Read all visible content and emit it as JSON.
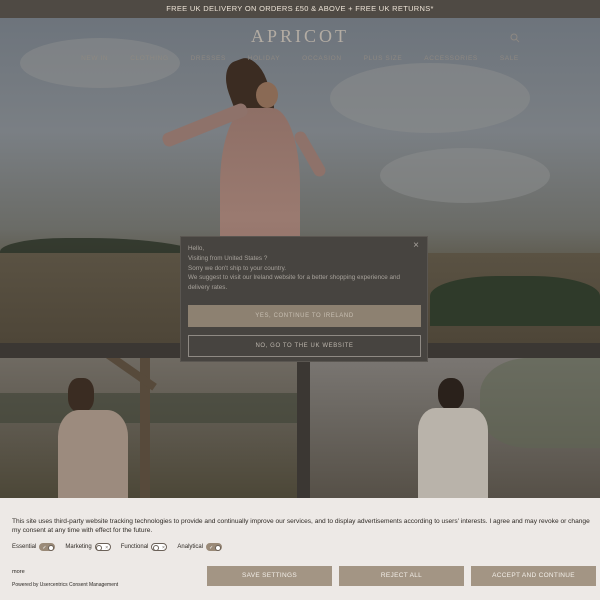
{
  "announcement": "FREE UK DELIVERY ON ORDERS £50 & ABOVE + FREE UK RETURNS*",
  "brand": {
    "logo_text": "APRICOT"
  },
  "header": {
    "icons": [
      "search-icon",
      "account-icon",
      "wishlist-icon",
      "bag-icon"
    ]
  },
  "nav": {
    "items": [
      "NEW IN",
      "CLOTHING",
      "DRESSES",
      "HOLIDAY",
      "OCCASION",
      "PLUS SIZE",
      "ACCESSORIES",
      "SALE"
    ]
  },
  "geo_popup": {
    "close_icon": "close-icon",
    "lines": [
      "Hello,",
      "Visiting from United States ?",
      "Sorry we don't ship to your country.",
      "We suggest to visit our Ireland website for a better shopping experience and delivery rates."
    ],
    "primary_button": "YES, CONTINUE TO IRELAND",
    "secondary_button": "NO, GO TO THE UK WEBSITE"
  },
  "cookie_banner": {
    "text": "This site uses third-party website tracking technologies to provide and continually improve our services, and to display advertisements according to users' interests. I agree and may revoke or change my consent at any time with effect for the future.",
    "toggles": [
      {
        "label": "Essential",
        "on": true
      },
      {
        "label": "Marketing",
        "on": false
      },
      {
        "label": "Functional",
        "on": false
      },
      {
        "label": "Analytical",
        "on": true
      }
    ],
    "more_link": "more",
    "powered_by": "Powered by Usercentrics Consent Management",
    "buttons": {
      "save": "SAVE SETTINGS",
      "reject": "REJECT ALL",
      "accept": "ACCEPT AND CONTINUE"
    }
  }
}
